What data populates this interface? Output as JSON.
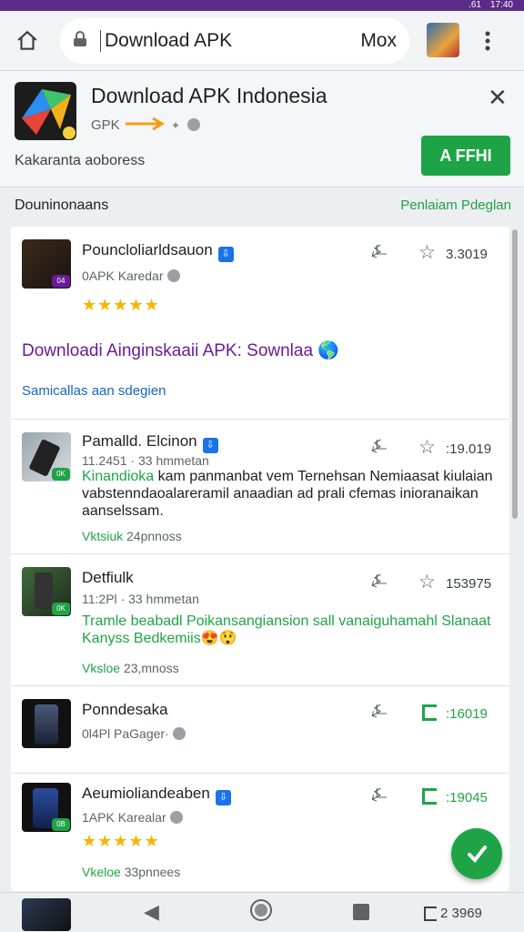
{
  "status": {
    "left": "",
    "right": [
      ".61",
      "17:40"
    ]
  },
  "toolbar": {
    "url": "Download APK",
    "right_text": "Mox",
    "icons": [
      "home-icon",
      "lock-icon",
      "avatar",
      "more-vert-icon"
    ]
  },
  "banner": {
    "title": "Download APK Indonesia",
    "subtitle": "GPK",
    "description": "Kakaranta aoboress",
    "install_label": "A FFHI",
    "close_glyph": "✕"
  },
  "section": {
    "title": "Douninonaans",
    "link": "Penlaiam Pdeglan"
  },
  "items": [
    {
      "title": "Pouncloliarldsauon",
      "subtitle": "0APK Karedar",
      "stars": "★★★★★",
      "metric": "3.3019",
      "badge": "04"
    },
    {
      "title": "Pamalld. Elcinon",
      "subtitle": "11.2451 · 33 hmmetan",
      "desc_green": "Kinandioka",
      "desc_rest": " kam panmanbat vem Ternehsan Nemiaasat kiulaian vabstenndaoalareramil anaadian ad prali cfemas inioranaikan aanselssam.",
      "foot_green": "Vktsiuk",
      "foot_rest": " 24pnnoss",
      "metric": ":19.019",
      "badge": "0K"
    },
    {
      "title": "Detfiulk",
      "subtitle": "11:2Pl · 33 hmmetan",
      "desc_green": "Tramle beabadl Poikansangiansion sall vanaiguhamahl Slanaat Kanyss Bedkemiis😍😲",
      "foot_green": "Vksloe",
      "foot_rest": " 23,mnoss",
      "metric": "153975",
      "badge": "0K"
    },
    {
      "title": "Ponndesaka",
      "subtitle": "0l4Pl PaGager·",
      "metric": ":16019"
    },
    {
      "title": "Aeumioliandeaben",
      "subtitle": "1APK Karealar",
      "stars": "★★★★★",
      "foot_green": "Vkeloe",
      "foot_rest": " 33pnnees",
      "metric": ":19045",
      "badge": "0B"
    }
  ],
  "promo": {
    "title": "Downloadi Ainginskaaii APK: Sownlaa 🌎",
    "link": "Samicallas aan sdegien"
  },
  "navbar": {
    "metric": "2 3969"
  },
  "colors": {
    "accent": "#1ea446",
    "status": "#5b2c87",
    "promo": "#6a1b9a"
  }
}
